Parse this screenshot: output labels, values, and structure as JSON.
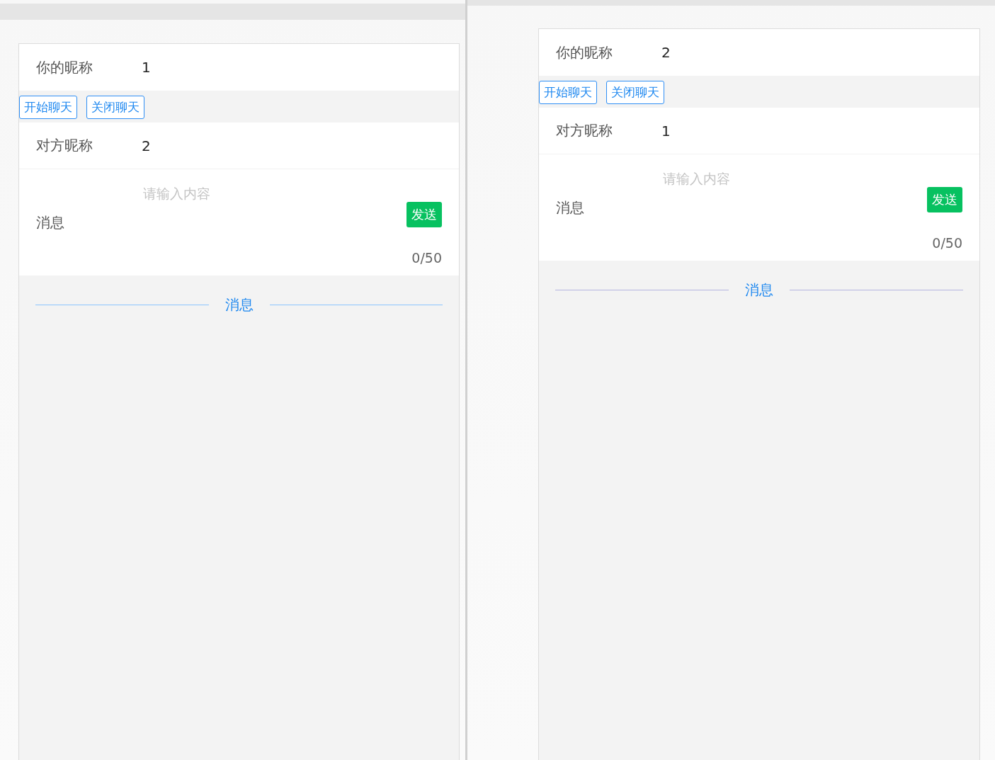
{
  "panes": [
    {
      "my_nickname": {
        "label": "你的昵称",
        "value": "1"
      },
      "buttons": [
        "开始聊天",
        "关闭聊天"
      ],
      "peer_nickname": {
        "label": "对方昵称",
        "value": "2"
      },
      "message": {
        "label": "消息",
        "placeholder": "请输入内容",
        "send": "发送",
        "counter": "0/50"
      },
      "divider": "消息"
    },
    {
      "my_nickname": {
        "label": "你的昵称",
        "value": "2"
      },
      "buttons": [
        "开始聊天",
        "关闭聊天"
      ],
      "peer_nickname": {
        "label": "对方昵称",
        "value": "1"
      },
      "message": {
        "label": "消息",
        "placeholder": "请输入内容",
        "send": "发送",
        "counter": "0/50"
      },
      "divider": "消息"
    }
  ]
}
